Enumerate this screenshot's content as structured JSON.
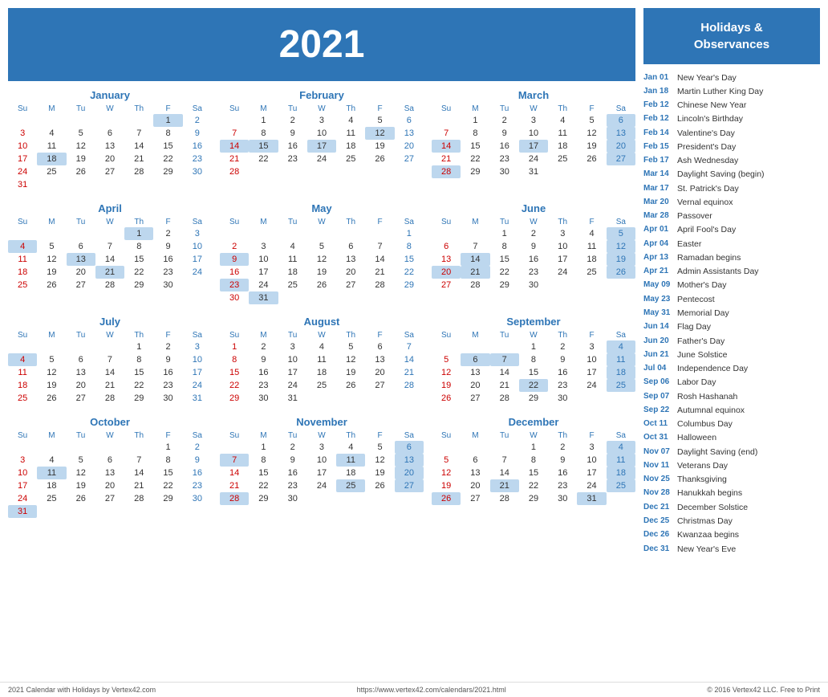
{
  "year": "2021",
  "months": [
    {
      "name": "January",
      "startDay": 5,
      "days": 31,
      "highlights": [
        1,
        18
      ],
      "satHighlights": [],
      "weeks": [
        [
          "",
          "",
          "",
          "",
          "",
          1,
          2
        ],
        [
          3,
          4,
          5,
          6,
          7,
          8,
          9
        ],
        [
          10,
          11,
          12,
          13,
          14,
          15,
          16
        ],
        [
          17,
          18,
          19,
          20,
          21,
          22,
          23
        ],
        [
          24,
          25,
          26,
          27,
          28,
          29,
          30
        ],
        [
          31,
          "",
          "",
          "",
          "",
          "",
          ""
        ]
      ]
    },
    {
      "name": "February",
      "startDay": 1,
      "days": 28,
      "highlights": [
        12,
        14,
        15,
        17
      ],
      "weeks": [
        [
          "",
          1,
          2,
          3,
          4,
          5,
          6
        ],
        [
          7,
          8,
          9,
          10,
          11,
          12,
          13
        ],
        [
          14,
          15,
          16,
          17,
          18,
          19,
          20
        ],
        [
          21,
          22,
          23,
          24,
          25,
          26,
          27
        ],
        [
          28,
          "",
          "",
          "",
          "",
          "",
          ""
        ]
      ]
    },
    {
      "name": "March",
      "startDay": 1,
      "days": 31,
      "highlights": [
        14,
        17,
        20,
        28
      ],
      "blueHighlights": [
        6,
        13,
        20,
        27
      ],
      "weeks": [
        [
          "",
          1,
          2,
          3,
          4,
          5,
          6
        ],
        [
          7,
          8,
          9,
          10,
          11,
          12,
          13
        ],
        [
          14,
          15,
          16,
          17,
          18,
          19,
          20
        ],
        [
          21,
          22,
          23,
          24,
          25,
          26,
          27
        ],
        [
          28,
          29,
          30,
          31,
          "",
          "",
          ""
        ]
      ]
    },
    {
      "name": "April",
      "startDay": 4,
      "days": 30,
      "highlights": [
        1,
        4,
        13,
        21
      ],
      "weeks": [
        [
          "",
          "",
          "",
          "",
          1,
          2,
          3
        ],
        [
          4,
          5,
          6,
          7,
          8,
          9,
          10
        ],
        [
          11,
          12,
          13,
          14,
          15,
          16,
          17
        ],
        [
          18,
          19,
          20,
          21,
          22,
          23,
          24
        ],
        [
          25,
          26,
          27,
          28,
          29,
          30,
          ""
        ]
      ]
    },
    {
      "name": "May",
      "startDay": 6,
      "days": 31,
      "highlights": [
        9,
        23,
        31
      ],
      "weeks": [
        [
          "",
          "",
          "",
          "",
          "",
          "",
          1
        ],
        [
          2,
          3,
          4,
          5,
          6,
          7,
          8
        ],
        [
          9,
          10,
          11,
          12,
          13,
          14,
          15
        ],
        [
          16,
          17,
          18,
          19,
          20,
          21,
          22
        ],
        [
          23,
          24,
          25,
          26,
          27,
          28,
          29
        ],
        [
          30,
          31,
          "",
          "",
          "",
          "",
          ""
        ]
      ]
    },
    {
      "name": "June",
      "startDay": 2,
      "days": 30,
      "highlights": [
        14,
        20,
        21
      ],
      "blueHighlights": [
        5,
        12,
        19,
        26
      ],
      "weeks": [
        [
          "",
          "",
          1,
          2,
          3,
          4,
          5
        ],
        [
          6,
          7,
          8,
          9,
          10,
          11,
          12
        ],
        [
          13,
          14,
          15,
          16,
          17,
          18,
          19
        ],
        [
          20,
          21,
          22,
          23,
          24,
          25,
          26
        ],
        [
          27,
          28,
          29,
          30,
          "",
          "",
          ""
        ]
      ]
    },
    {
      "name": "July",
      "startDay": 4,
      "days": 31,
      "highlights": [
        4
      ],
      "weeks": [
        [
          "",
          "",
          "",
          "",
          1,
          2,
          3
        ],
        [
          4,
          5,
          6,
          7,
          8,
          9,
          10
        ],
        [
          11,
          12,
          13,
          14,
          15,
          16,
          17
        ],
        [
          18,
          19,
          20,
          21,
          22,
          23,
          24
        ],
        [
          25,
          26,
          27,
          28,
          29,
          30,
          31
        ]
      ]
    },
    {
      "name": "August",
      "startDay": 0,
      "days": 31,
      "highlights": [],
      "weeks": [
        [
          1,
          2,
          3,
          4,
          5,
          6,
          7
        ],
        [
          8,
          9,
          10,
          11,
          12,
          13,
          14
        ],
        [
          15,
          16,
          17,
          18,
          19,
          20,
          21
        ],
        [
          22,
          23,
          24,
          25,
          26,
          27,
          28
        ],
        [
          29,
          30,
          31,
          "",
          "",
          "",
          ""
        ]
      ]
    },
    {
      "name": "September",
      "startDay": 3,
      "days": 30,
      "highlights": [
        6,
        7,
        22
      ],
      "blueHighlights": [
        4,
        11,
        18,
        25
      ],
      "weeks": [
        [
          "",
          "",
          "",
          1,
          2,
          3,
          4
        ],
        [
          5,
          6,
          7,
          8,
          9,
          10,
          11
        ],
        [
          12,
          13,
          14,
          15,
          16,
          17,
          18
        ],
        [
          19,
          20,
          21,
          22,
          23,
          24,
          25
        ],
        [
          26,
          27,
          28,
          29,
          30,
          "",
          ""
        ]
      ]
    },
    {
      "name": "October",
      "startDay": 5,
      "days": 31,
      "highlights": [
        11,
        31
      ],
      "weeks": [
        [
          "",
          "",
          "",
          "",
          "",
          1,
          2
        ],
        [
          3,
          4,
          5,
          6,
          7,
          8,
          9
        ],
        [
          10,
          11,
          12,
          13,
          14,
          15,
          16
        ],
        [
          17,
          18,
          19,
          20,
          21,
          22,
          23
        ],
        [
          24,
          25,
          26,
          27,
          28,
          29,
          30
        ],
        [
          31,
          "",
          "",
          "",
          "",
          "",
          ""
        ]
      ]
    },
    {
      "name": "November",
      "startDay": 1,
      "days": 30,
      "highlights": [
        7,
        11,
        25,
        28
      ],
      "blueHighlights": [
        6,
        13,
        20,
        27
      ],
      "weeks": [
        [
          "",
          1,
          2,
          3,
          4,
          5,
          6
        ],
        [
          7,
          8,
          9,
          10,
          11,
          12,
          13
        ],
        [
          14,
          15,
          16,
          17,
          18,
          19,
          20
        ],
        [
          21,
          22,
          23,
          24,
          25,
          26,
          27
        ],
        [
          28,
          29,
          30,
          "",
          "",
          "",
          ""
        ]
      ]
    },
    {
      "name": "December",
      "startDay": 3,
      "days": 31,
      "highlights": [
        21,
        25,
        26,
        31
      ],
      "blueHighlights": [
        4,
        11,
        18,
        25
      ],
      "weeks": [
        [
          "",
          "",
          "",
          1,
          2,
          3,
          4
        ],
        [
          5,
          6,
          7,
          8,
          9,
          10,
          11
        ],
        [
          12,
          13,
          14,
          15,
          16,
          17,
          18
        ],
        [
          19,
          20,
          21,
          22,
          23,
          24,
          25
        ],
        [
          26,
          27,
          28,
          29,
          30,
          31,
          ""
        ]
      ]
    }
  ],
  "holidays": [
    {
      "date": "Jan 01",
      "name": "New Year's Day"
    },
    {
      "date": "Jan 18",
      "name": "Martin Luther King Day"
    },
    {
      "date": "Feb 12",
      "name": "Chinese New Year"
    },
    {
      "date": "Feb 12",
      "name": "Lincoln's Birthday"
    },
    {
      "date": "Feb 14",
      "name": "Valentine's Day"
    },
    {
      "date": "Feb 15",
      "name": "President's Day"
    },
    {
      "date": "Feb 17",
      "name": "Ash Wednesday"
    },
    {
      "date": "Mar 14",
      "name": "Daylight Saving (begin)"
    },
    {
      "date": "Mar 17",
      "name": "St. Patrick's Day"
    },
    {
      "date": "Mar 20",
      "name": "Vernal equinox"
    },
    {
      "date": "Mar 28",
      "name": "Passover"
    },
    {
      "date": "Apr 01",
      "name": "April Fool's Day"
    },
    {
      "date": "Apr 04",
      "name": "Easter"
    },
    {
      "date": "Apr 13",
      "name": "Ramadan begins"
    },
    {
      "date": "Apr 21",
      "name": "Admin Assistants Day"
    },
    {
      "date": "May 09",
      "name": "Mother's Day"
    },
    {
      "date": "May 23",
      "name": "Pentecost"
    },
    {
      "date": "May 31",
      "name": "Memorial Day"
    },
    {
      "date": "Jun 14",
      "name": "Flag Day"
    },
    {
      "date": "Jun 20",
      "name": "Father's Day"
    },
    {
      "date": "Jun 21",
      "name": "June Solstice"
    },
    {
      "date": "Jul 04",
      "name": "Independence Day"
    },
    {
      "date": "Sep 06",
      "name": "Labor Day"
    },
    {
      "date": "Sep 07",
      "name": "Rosh Hashanah"
    },
    {
      "date": "Sep 22",
      "name": "Autumnal equinox"
    },
    {
      "date": "Oct 11",
      "name": "Columbus Day"
    },
    {
      "date": "Oct 31",
      "name": "Halloween"
    },
    {
      "date": "Nov 07",
      "name": "Daylight Saving (end)"
    },
    {
      "date": "Nov 11",
      "name": "Veterans Day"
    },
    {
      "date": "Nov 25",
      "name": "Thanksgiving"
    },
    {
      "date": "Nov 28",
      "name": "Hanukkah begins"
    },
    {
      "date": "Dec 21",
      "name": "December Solstice"
    },
    {
      "date": "Dec 25",
      "name": "Christmas Day"
    },
    {
      "date": "Dec 26",
      "name": "Kwanzaa begins"
    },
    {
      "date": "Dec 31",
      "name": "New Year's Eve"
    }
  ],
  "sidebar_title": "Holidays &\nObservances",
  "footer": {
    "left": "2021 Calendar with Holidays by Vertex42.com",
    "center": "https://www.vertex42.com/calendars/2021.html",
    "right": "© 2016 Vertex42 LLC. Free to Print"
  },
  "days_header": [
    "Su",
    "M",
    "Tu",
    "W",
    "Th",
    "F",
    "Sa"
  ]
}
